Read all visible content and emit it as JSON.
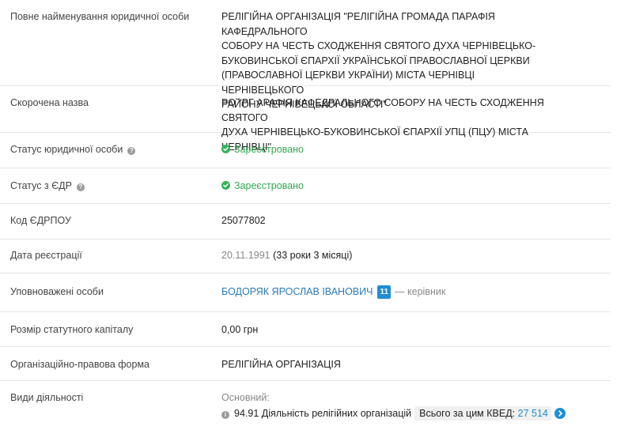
{
  "rows": {
    "full_name": {
      "label": "Повне найменування юридичної особи",
      "lines": [
        "РЕЛІГІЙНА ОРГАНІЗАЦІЯ \"РЕЛІГІЙНА ГРОМАДА ПАРАФІЯ КАФЕДРАЛЬНОГО",
        "СОБОРУ НА ЧЕСТЬ СХОДЖЕННЯ СВЯТОГО ДУХА ЧЕРНІВЕЦЬКО-",
        "БУКОВИНСЬКОЇ ЄПАРХІЇ УКРАЇНСЬКОЇ ПРАВОСЛАВНОЇ ЦЕРКВИ",
        "(ПРАВОСЛАВНОЇ ЦЕРКВИ УКРАЇНИ) МІСТА ЧЕРНІВЦІ ЧЕРНІВЕЦЬКОГО",
        "РАЙОНУ ЧЕРНІВЕЦЬКОЇ ОБЛАСТІ\""
      ]
    },
    "short_name": {
      "label": "Скорочена назва",
      "lines": [
        "РО \"РГ АРАФІЯ КАФЕДРАЛЬНОГО СОБОРУ НА ЧЕСТЬ СХОДЖЕННЯ СВЯТОГО",
        "ДУХА ЧЕРНІВЕЦЬКО-БУКОВИНСЬКОЇ ЄПАРХІЇ УПЦ (ПЦУ) МІСТА ЧЕРНІВЦІ\""
      ]
    },
    "legal_status": {
      "label": "Статус юридичної особи",
      "help_icon": "?",
      "value": "Зареєстровано",
      "icon": "check-circle-icon"
    },
    "edr_status": {
      "label": "Статус з ЄДР",
      "help_icon": "?",
      "value": "Зареєстровано",
      "icon": "check-circle-icon"
    },
    "edrpou": {
      "label": "Код ЄДРПОУ",
      "value": "25077802"
    },
    "reg_date": {
      "label": "Дата реєстрації",
      "date": "20.11.1991",
      "age": "(33 роки 3 місяці)"
    },
    "authorized": {
      "label": "Уповноважені особи",
      "person": "БОДОРЯК ЯРОСЛАВ ІВАНОВИЧ",
      "badge": "11",
      "role": "— керівник"
    },
    "capital": {
      "label": "Розмір статутного капіталу",
      "value": "0,00 грн"
    },
    "legal_form": {
      "label": "Організаційно-правова форма",
      "value": "РЕЛІГІЙНА ОРГАНІЗАЦІЯ"
    },
    "activities": {
      "label": "Види діяльності",
      "primary_label": "Основний:",
      "info_icon": "i",
      "kved": "94.91 Діяльність релігійних організацій",
      "kved_total_label": "Всього за цим КВЕД:",
      "kved_total_count": "27 514"
    }
  },
  "colors": {
    "status_green": "#34a853",
    "link_blue": "#2a7ab8",
    "badge_blue": "#1d8ed6",
    "divider": "#e6e6e6"
  }
}
